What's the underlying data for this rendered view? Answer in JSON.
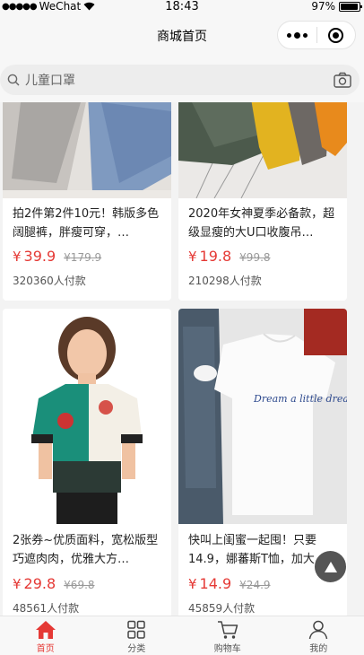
{
  "status_bar": {
    "carrier": "WeChat",
    "time": "18:43",
    "battery": "97%",
    "battery_level": 0.97
  },
  "nav": {
    "title": "商城首页"
  },
  "search": {
    "placeholder": "儿童口罩"
  },
  "products": [
    {
      "title": "拍2件第2件10元！韩版多色阔腿裤，胖瘦可穿，…",
      "yen": "¥",
      "price": "39.9",
      "original_price": "¥179.9",
      "sales": "320360人付款"
    },
    {
      "title": "2020年女神夏季必备款，超级显瘦的大U口收腹吊…",
      "yen": "¥",
      "price": "19.8",
      "original_price": "¥99.8",
      "sales": "210298人付款"
    },
    {
      "title": "2张券~优质面料，宽松版型巧遮肉肉，优雅大方…",
      "yen": "¥",
      "price": "29.8",
      "original_price": "¥69.8",
      "sales": "48561人付款"
    },
    {
      "title": "快叫上闺蜜一起囤！只要14.9，娜蕃斯T恤，加大…",
      "yen": "¥",
      "price": "14.9",
      "original_price": "¥24.9",
      "sales": "45859人付款"
    }
  ],
  "product_images": [
    {
      "description": "grey-blue-fabric"
    },
    {
      "description": "colorful-tops-on-hangers"
    },
    {
      "description": "woman-green-floral-top"
    },
    {
      "description": "white-tshirt-jeans-flatlay",
      "print": "Dream a little dream"
    }
  ],
  "tabs": [
    {
      "label": "首页",
      "icon": "home-icon",
      "active": true
    },
    {
      "label": "分类",
      "icon": "grid-icon",
      "active": false
    },
    {
      "label": "购物车",
      "icon": "cart-icon",
      "active": false
    },
    {
      "label": "我的",
      "icon": "user-icon",
      "active": false
    }
  ],
  "colors": {
    "accent": "#e53935",
    "background": "#f3f3f3"
  }
}
